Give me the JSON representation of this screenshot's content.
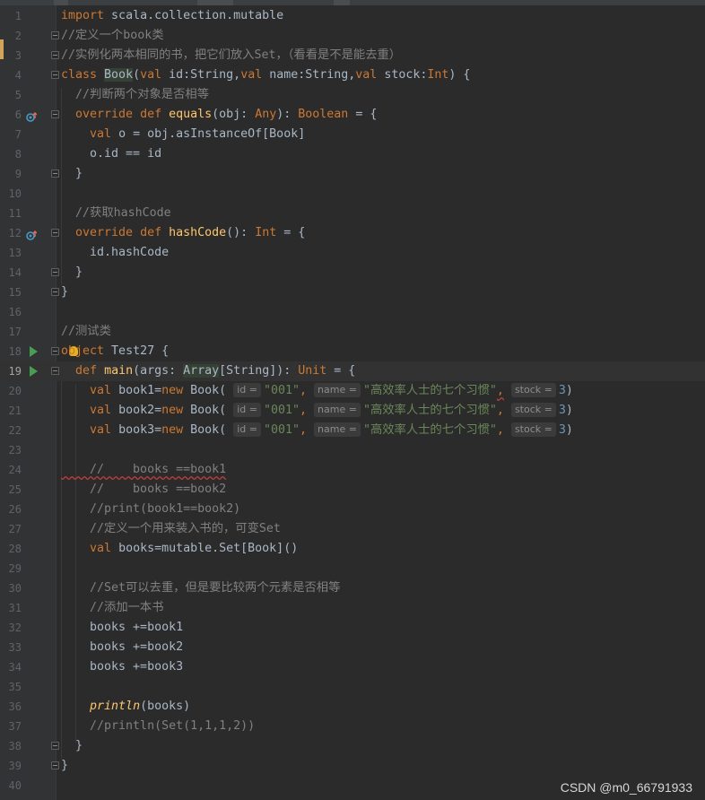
{
  "editor": {
    "current_line": "19",
    "lines": [
      {
        "no": "1",
        "parts": [
          {
            "t": "import",
            "c": "kw"
          },
          {
            "t": " scala.collection.mutable",
            "c": "pl"
          }
        ]
      },
      {
        "no": "2",
        "parts": [
          {
            "t": "//定义一个book类",
            "c": "cm"
          }
        ]
      },
      {
        "no": "3",
        "parts": [
          {
            "t": "//实例化两本相同的书，把它们放入Set，（看看是不是能去重）",
            "c": "cm"
          }
        ]
      },
      {
        "no": "4",
        "parts": [
          {
            "t": "class",
            "c": "kw"
          },
          {
            "t": " ",
            "c": "pl"
          },
          {
            "t": "Book",
            "c": "hl"
          },
          {
            "t": "(",
            "c": "pl"
          },
          {
            "t": "val",
            "c": "kw"
          },
          {
            "t": " id:String,",
            "c": "pl"
          },
          {
            "t": "val",
            "c": "kw"
          },
          {
            "t": " name:String,",
            "c": "pl"
          },
          {
            "t": "val",
            "c": "kw"
          },
          {
            "t": " stock:",
            "c": "pl"
          },
          {
            "t": "Int",
            "c": "kw"
          },
          {
            "t": ") {",
            "c": "pl"
          }
        ]
      },
      {
        "no": "5",
        "parts": [
          {
            "t": "  //判断两个对象是否相等",
            "c": "cm"
          }
        ]
      },
      {
        "no": "6",
        "parts": [
          {
            "t": "  ",
            "c": "pl"
          },
          {
            "t": "override def",
            "c": "kw"
          },
          {
            "t": " ",
            "c": "pl"
          },
          {
            "t": "equals",
            "c": "fn"
          },
          {
            "t": "(obj: ",
            "c": "pl"
          },
          {
            "t": "Any",
            "c": "kw"
          },
          {
            "t": "): ",
            "c": "pl"
          },
          {
            "t": "Boolean",
            "c": "kw"
          },
          {
            "t": " = {",
            "c": "pl"
          }
        ]
      },
      {
        "no": "7",
        "parts": [
          {
            "t": "    ",
            "c": "pl"
          },
          {
            "t": "val",
            "c": "kw"
          },
          {
            "t": " o = obj.asInstanceOf[Book]",
            "c": "pl"
          }
        ]
      },
      {
        "no": "8",
        "parts": [
          {
            "t": "    o.id == id",
            "c": "pl"
          }
        ]
      },
      {
        "no": "9",
        "parts": [
          {
            "t": "  }",
            "c": "pl"
          }
        ]
      },
      {
        "no": "10",
        "parts": []
      },
      {
        "no": "11",
        "parts": [
          {
            "t": "  //获取hashCode",
            "c": "cm"
          }
        ]
      },
      {
        "no": "12",
        "parts": [
          {
            "t": "  ",
            "c": "pl"
          },
          {
            "t": "override def",
            "c": "kw"
          },
          {
            "t": " ",
            "c": "pl"
          },
          {
            "t": "hashCode",
            "c": "fn"
          },
          {
            "t": "(): ",
            "c": "pl"
          },
          {
            "t": "Int",
            "c": "kw"
          },
          {
            "t": " = {",
            "c": "pl"
          }
        ]
      },
      {
        "no": "13",
        "parts": [
          {
            "t": "    id.hashCode",
            "c": "pl"
          }
        ]
      },
      {
        "no": "14",
        "parts": [
          {
            "t": "  }",
            "c": "pl"
          }
        ]
      },
      {
        "no": "15",
        "parts": [
          {
            "t": "}",
            "c": "pl"
          }
        ]
      },
      {
        "no": "16",
        "parts": []
      },
      {
        "no": "17",
        "parts": [
          {
            "t": "//测试类",
            "c": "cm"
          }
        ]
      },
      {
        "no": "18",
        "parts": [
          {
            "t": "object",
            "c": "kw"
          },
          {
            "t": " Test27 {",
            "c": "pl"
          }
        ]
      },
      {
        "no": "19",
        "parts": [
          {
            "t": "  ",
            "c": "pl"
          },
          {
            "t": "def",
            "c": "kw"
          },
          {
            "t": " ",
            "c": "pl"
          },
          {
            "t": "main",
            "c": "fn"
          },
          {
            "t": "(args: ",
            "c": "pl"
          },
          {
            "t": "Array",
            "c": "hl"
          },
          {
            "t": "[String]): ",
            "c": "pl"
          },
          {
            "t": "Unit",
            "c": "kw"
          },
          {
            "t": " = {",
            "c": "pl"
          }
        ]
      },
      {
        "no": "20",
        "parts": [
          {
            "t": "    ",
            "c": "pl"
          },
          {
            "t": "val",
            "c": "kw"
          },
          {
            "t": " book1=",
            "c": "pl"
          },
          {
            "t": "new",
            "c": "kw"
          },
          {
            "t": " Book( ",
            "c": "pl"
          },
          {
            "t": "id =",
            "c": "hint"
          },
          {
            "t": "\"001\"",
            "c": "st"
          },
          {
            "t": ",",
            "c": "kw"
          },
          {
            "t": " ",
            "c": "pl"
          },
          {
            "t": "name =",
            "c": "hint"
          },
          {
            "t": "\"高效率人士的七个习惯\"",
            "c": "st"
          },
          {
            "t": ",",
            "c": "kw"
          },
          {
            "t": " ",
            "c": "pl"
          },
          {
            "t": "stock =",
            "c": "hint"
          },
          {
            "t": "3",
            "c": "nm"
          },
          {
            "t": ")",
            "c": "pl"
          }
        ]
      },
      {
        "no": "21",
        "parts": [
          {
            "t": "    ",
            "c": "pl"
          },
          {
            "t": "val",
            "c": "kw"
          },
          {
            "t": " book2=",
            "c": "pl"
          },
          {
            "t": "new",
            "c": "kw"
          },
          {
            "t": " Book( ",
            "c": "pl"
          },
          {
            "t": "id =",
            "c": "hint"
          },
          {
            "t": "\"001\"",
            "c": "st"
          },
          {
            "t": ",",
            "c": "kw"
          },
          {
            "t": " ",
            "c": "pl"
          },
          {
            "t": "name =",
            "c": "hint"
          },
          {
            "t": "\"高效率人士的七个习惯\"",
            "c": "st"
          },
          {
            "t": ",",
            "c": "kw"
          },
          {
            "t": " ",
            "c": "pl"
          },
          {
            "t": "stock =",
            "c": "hint"
          },
          {
            "t": "3",
            "c": "nm"
          },
          {
            "t": ")",
            "c": "pl"
          }
        ]
      },
      {
        "no": "22",
        "parts": [
          {
            "t": "    ",
            "c": "pl"
          },
          {
            "t": "val",
            "c": "kw"
          },
          {
            "t": " book3=",
            "c": "pl"
          },
          {
            "t": "new",
            "c": "kw"
          },
          {
            "t": " Book( ",
            "c": "pl"
          },
          {
            "t": "id =",
            "c": "hint"
          },
          {
            "t": "\"001\"",
            "c": "st"
          },
          {
            "t": ",",
            "c": "kw"
          },
          {
            "t": " ",
            "c": "pl"
          },
          {
            "t": "name =",
            "c": "hint"
          },
          {
            "t": "\"高效率人士的七个习惯\"",
            "c": "st"
          },
          {
            "t": ",",
            "c": "kw"
          },
          {
            "t": " ",
            "c": "pl"
          },
          {
            "t": "stock =",
            "c": "hint"
          },
          {
            "t": "3",
            "c": "nm"
          },
          {
            "t": ")",
            "c": "pl"
          }
        ]
      },
      {
        "no": "23",
        "parts": []
      },
      {
        "no": "24",
        "parts": [
          {
            "t": "    //    books ==book1",
            "c": "cm"
          }
        ]
      },
      {
        "no": "25",
        "parts": [
          {
            "t": "    //    books ==book2",
            "c": "cm"
          }
        ]
      },
      {
        "no": "26",
        "parts": [
          {
            "t": "    //print(book1==book2)",
            "c": "cm"
          }
        ]
      },
      {
        "no": "27",
        "parts": [
          {
            "t": "    //定义一个用来装入书的，可变Set",
            "c": "cm"
          }
        ]
      },
      {
        "no": "28",
        "parts": [
          {
            "t": "    ",
            "c": "pl"
          },
          {
            "t": "val",
            "c": "kw"
          },
          {
            "t": " books=mutable.Set[Book]()",
            "c": "pl"
          }
        ]
      },
      {
        "no": "29",
        "parts": []
      },
      {
        "no": "30",
        "parts": [
          {
            "t": "    //Set可以去重，但是要比较两个元素是否相等",
            "c": "cm"
          }
        ]
      },
      {
        "no": "31",
        "parts": [
          {
            "t": "    //添加一本书",
            "c": "cm"
          }
        ]
      },
      {
        "no": "32",
        "parts": [
          {
            "t": "    books +=book1",
            "c": "pl"
          }
        ]
      },
      {
        "no": "33",
        "parts": [
          {
            "t": "    books +=book2",
            "c": "pl"
          }
        ]
      },
      {
        "no": "34",
        "parts": [
          {
            "t": "    books +=book3",
            "c": "pl"
          }
        ]
      },
      {
        "no": "35",
        "parts": []
      },
      {
        "no": "36",
        "parts": [
          {
            "t": "    ",
            "c": "pl"
          },
          {
            "t": "println",
            "c": "it"
          },
          {
            "t": "(books)",
            "c": "pl"
          }
        ]
      },
      {
        "no": "37",
        "parts": [
          {
            "t": "    //println(Set(1,1,1,2))",
            "c": "cm"
          }
        ]
      },
      {
        "no": "38",
        "parts": [
          {
            "t": "  }",
            "c": "pl"
          }
        ]
      },
      {
        "no": "39",
        "parts": [
          {
            "t": "}",
            "c": "pl"
          }
        ]
      },
      {
        "no": "40",
        "parts": []
      }
    ]
  },
  "watermark": "CSDN @m0_66791933"
}
